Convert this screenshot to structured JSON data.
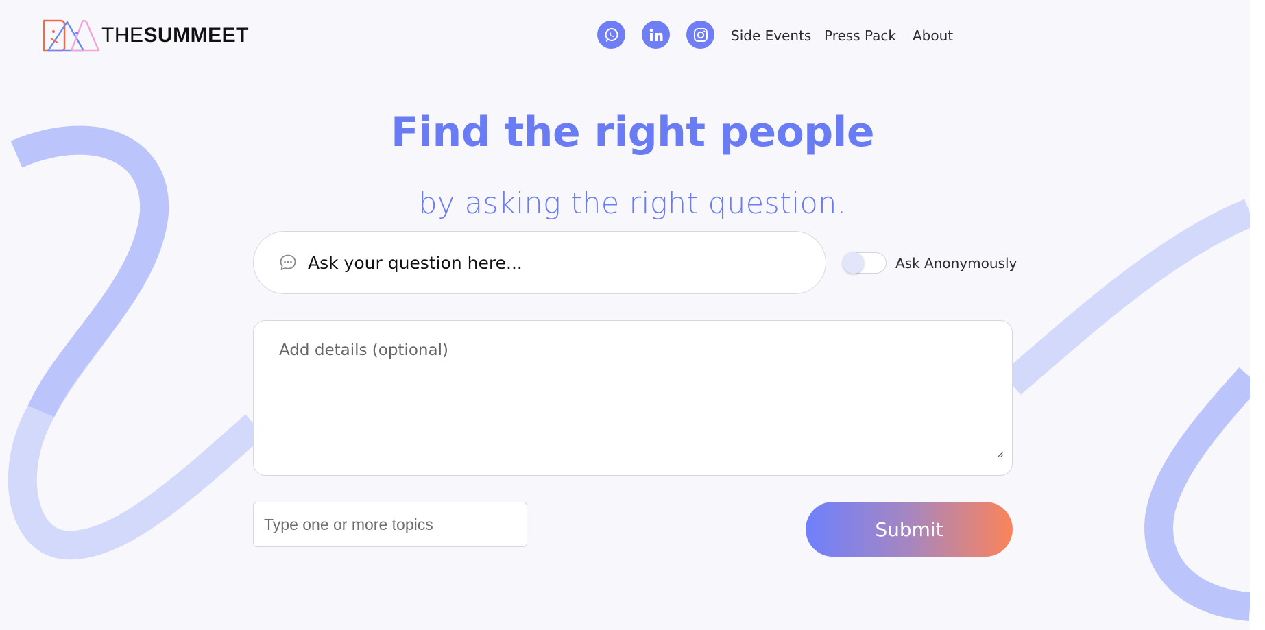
{
  "brand": {
    "name_light": "THE",
    "name_bold": "SUMMEET",
    "logo_icon": "summeet-birds-logo"
  },
  "nav": {
    "social": [
      {
        "name": "whatsapp-icon"
      },
      {
        "name": "linkedin-icon"
      },
      {
        "name": "instagram-icon"
      }
    ],
    "links": [
      "Side Events",
      "Press Pack",
      "About"
    ]
  },
  "hero": {
    "title": "Find the right people",
    "subtitle": "by asking the right question."
  },
  "form": {
    "question_placeholder": "Ask your question here...",
    "question_icon": "chat-bubble-icon",
    "anonymous_label": "Ask Anonymously",
    "anonymous_enabled": false,
    "details_placeholder": "Add details (optional)",
    "topics_placeholder": "Type one or more topics",
    "submit_label": "Submit"
  },
  "colors": {
    "accent": "#6a7cf3",
    "background": "#f8f8fc",
    "submit_gradient_start": "#6f80fc",
    "submit_gradient_end": "#fb845a",
    "wave_light": "#d0d7fb",
    "wave_dark": "#b6c0fb"
  }
}
